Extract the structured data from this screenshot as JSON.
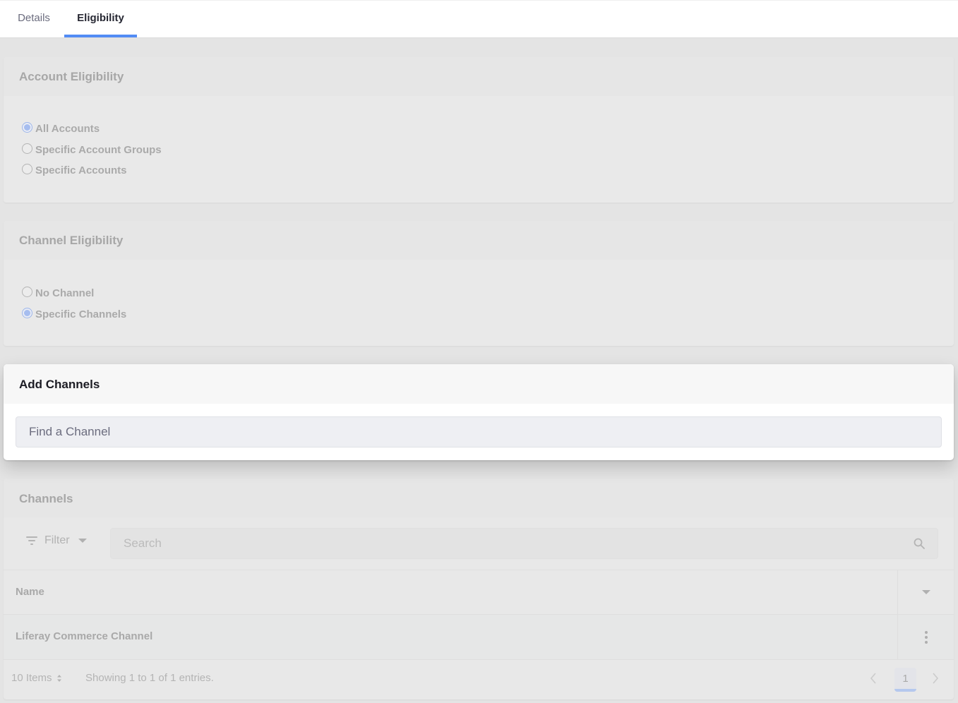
{
  "tabs": [
    {
      "label": "Details",
      "active": false
    },
    {
      "label": "Eligibility",
      "active": true
    }
  ],
  "account_eligibility": {
    "title": "Account Eligibility",
    "options": [
      {
        "label": "All Accounts",
        "checked": true
      },
      {
        "label": "Specific Account Groups",
        "checked": false
      },
      {
        "label": "Specific Accounts",
        "checked": false
      }
    ]
  },
  "channel_eligibility": {
    "title": "Channel Eligibility",
    "options": [
      {
        "label": "No Channel",
        "checked": false
      },
      {
        "label": "Specific Channels",
        "checked": true
      }
    ]
  },
  "add_channels": {
    "title": "Add Channels",
    "search_placeholder": "Find a Channel"
  },
  "channels": {
    "title": "Channels",
    "filter_label": "Filter",
    "search_placeholder": "Search",
    "columns": [
      "Name"
    ],
    "rows": [
      {
        "name": "Liferay Commerce Channel"
      }
    ],
    "pagination": {
      "items_per_page": "10 Items",
      "summary": "Showing 1 to 1 of 1 entries.",
      "current_page": "1"
    }
  },
  "colors": {
    "accent": "#528cf5",
    "checked_radio": "#a6bdef"
  },
  "icons": {
    "filter": "filter-icon",
    "search": "search-icon",
    "column_menu": "caret-down-icon",
    "row_actions": "kebab-icon",
    "prev": "chevron-left-icon",
    "next": "chevron-right-icon",
    "sort": "sort-icon"
  }
}
